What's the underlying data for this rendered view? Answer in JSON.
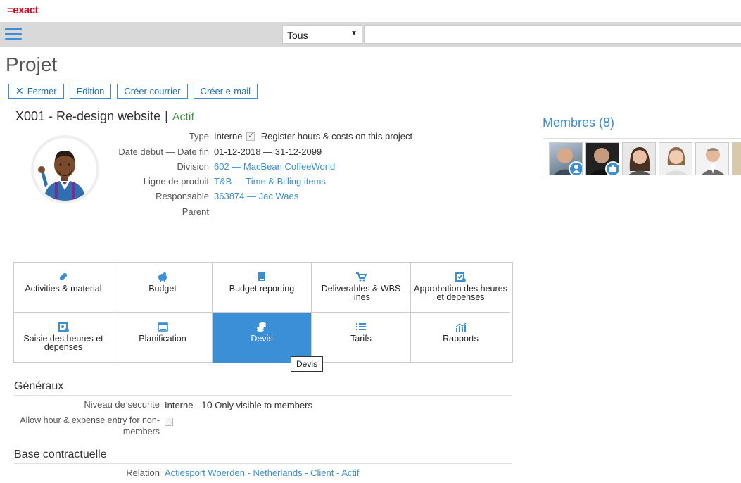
{
  "app": {
    "logo": "=exact"
  },
  "topbar": {
    "scope_value": "Tous",
    "search_placeholder": ""
  },
  "page": {
    "title": "Projet"
  },
  "toolbar": {
    "close_label": "Fermer",
    "edit_label": "Edition",
    "create_letter_label": "Créer courrier",
    "create_email_label": "Créer e-mail"
  },
  "project": {
    "code_name": "X001 - Re-design website",
    "separator": "|",
    "status": "Actif",
    "fields": {
      "type_label": "Type",
      "type_value": "Interne",
      "register_label": "Register hours & costs on this project",
      "register_checked": true,
      "dates_label": "Date debut — Date fin",
      "dates_value": "01-12-2018 — 31-12-2099",
      "division_label": "Division",
      "division_value": "602 — MacBean CoffeeWorld",
      "product_line_label": "Ligne de produit",
      "product_line_value": "T&B — Time & Billing items",
      "manager_label": "Responsable",
      "manager_value": "363874 — Jac Waes",
      "parent_label": "Parent",
      "parent_value": ""
    }
  },
  "tiles": [
    {
      "label": "Activities & material",
      "icon": "pill-icon"
    },
    {
      "label": "Budget",
      "icon": "piggy-bank-icon"
    },
    {
      "label": "Budget reporting",
      "icon": "ledger-icon"
    },
    {
      "label": "Deliverables & WBS lines",
      "icon": "cart-icon"
    },
    {
      "label": "Approbation des heures et depenses",
      "icon": "approval-icon"
    },
    {
      "label": "Saisie des heures et depenses",
      "icon": "time-entry-icon"
    },
    {
      "label": "Planification",
      "icon": "calendar-icon"
    },
    {
      "label": "Devis",
      "icon": "coins-icon",
      "active": true
    },
    {
      "label": "Tarifs",
      "icon": "list-icon"
    },
    {
      "label": "Rapports",
      "icon": "chart-icon"
    }
  ],
  "tooltip": {
    "text": "Devis"
  },
  "general": {
    "title": "Généraux",
    "security_label": "Niveau de securite",
    "security_value_prefix": "Interne - ",
    "security_value_level": "10",
    "security_value_desc": "Only visible to members",
    "allow_entry_label": "Allow hour & expense entry for non-members",
    "allow_entry_checked": false
  },
  "contract": {
    "title": "Base contractuelle",
    "relation_label": "Relation",
    "relation_value": "Actiesport Woerden - Netherlands - Client - Actif"
  },
  "members": {
    "title": "Membres (8)",
    "photos": [
      "member-1",
      "member-2",
      "member-3",
      "member-4",
      "member-5",
      "member-6"
    ]
  },
  "colors": {
    "accent": "#3a8fd6",
    "brand": "#e2001a",
    "status_active": "#3c9a3c"
  }
}
